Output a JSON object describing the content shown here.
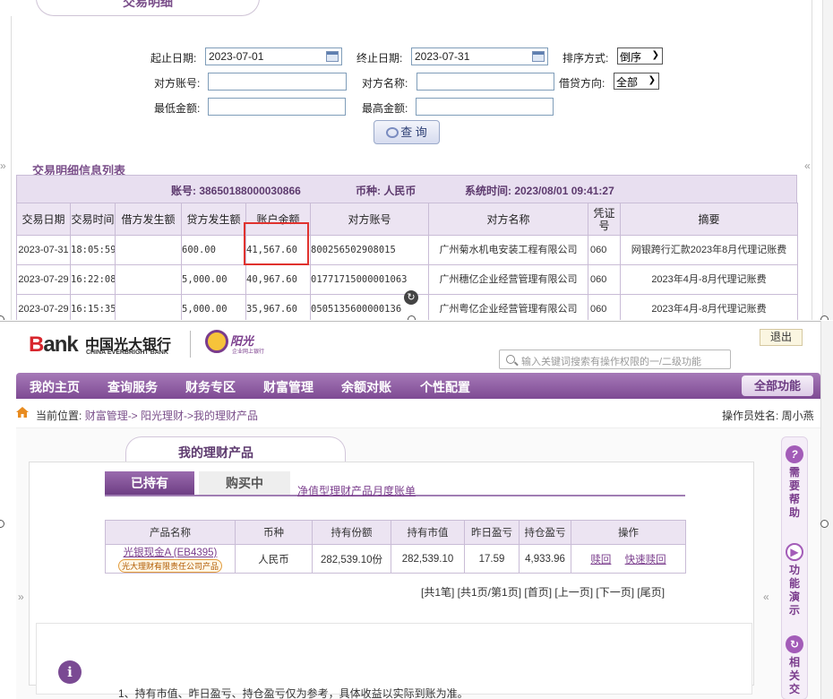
{
  "top": {
    "tab_title": "交易明细",
    "form": {
      "start_label": "起止日期:",
      "start_value": "2023-07-01",
      "end_label": "终止日期:",
      "end_value": "2023-07-31",
      "sort_label": "排序方式:",
      "sort_value": "倒序",
      "counter_acct_label": "对方账号:",
      "counter_name_label": "对方名称:",
      "direction_label": "借贷方向:",
      "direction_value": "全部",
      "min_label": "最低金额:",
      "max_label": "最高金额:",
      "query_label": "查 询"
    },
    "list_title": "交易明细信息列表",
    "account_info": {
      "account": "账号: 38650188000030866",
      "currency": "币种: 人民币",
      "system_time": "系统时间: 2023/08/01 09:41:27"
    },
    "table": {
      "headers": [
        "交易日期",
        "交易时间",
        "借方发生额",
        "贷方发生额",
        "账户余额",
        "对方账号",
        "对方名称",
        "凭证号",
        "摘要"
      ],
      "rows": [
        [
          "2023-07-31",
          "18:05:59",
          "",
          "600.00",
          "41,567.60",
          "800256502908015",
          "广州菊水机电安装工程有限公司",
          "060",
          "网银跨行汇款2023年8月代理记账费"
        ],
        [
          "2023-07-29",
          "16:22:08",
          "",
          "5,000.00",
          "40,967.60",
          "01771715000001063",
          "广州穗亿企业经营管理有限公司",
          "060",
          "2023年4月-8月代理记账费"
        ],
        [
          "2023-07-29",
          "16:15:35",
          "",
          "5,000.00",
          "35,967.60",
          "0505135600000136",
          "广州粤亿企业经营管理有限公司",
          "060",
          "2023年4月-8月代理记账费"
        ]
      ]
    }
  },
  "bottom": {
    "brand": {
      "bank_b": "B",
      "bank_rest": "ank",
      "cn_name": "中国光大银行",
      "en_name": "CHINA EVERBRIGHT BANK",
      "ygg": "阳光",
      "ygg_sub": "企业网上银行"
    },
    "logout": "退出",
    "search_placeholder": "输入关键词搜索有操作权限的一/二级功能",
    "nav": [
      "我的主页",
      "查询服务",
      "财务专区",
      "财富管理",
      "余额对账",
      "个性配置"
    ],
    "all_functions": "全部功能",
    "breadcrumb": {
      "prefix": "当前位置:",
      "path": "财富管理-> 阳光理财->我的理财产品"
    },
    "operator": "操作员姓名: 周小燕",
    "panel_title": "我的理财产品",
    "tabs": [
      "已持有",
      "购买中"
    ],
    "monthly_link": "净值型理财产品月度账单",
    "product_table": {
      "headers": [
        "产品名称",
        "币种",
        "持有份额",
        "持有市值",
        "昨日盈亏",
        "持仓盈亏",
        "操作"
      ],
      "row": {
        "name": "光银现金A (EB4395)",
        "issuer": "光大理财有限责任公司产品",
        "currency": "人民币",
        "shares": "282,539.10份",
        "market_value": "282,539.10",
        "yesterday_pl": "17.59",
        "position_pl": "4,933.96",
        "op1": "赎回",
        "op2": "快速赎回"
      }
    },
    "pager": "[共1笔] [共1页/第1页] [首页] [上一页] [下一页] [尾页]",
    "notice": "1、持有市值、昨日盈亏、持仓盈亏仅为参考，具体收益以实际到账为准。",
    "side": {
      "help": "需要帮助",
      "demo": "功能演示",
      "related": "相关交"
    },
    "colors": {
      "brand_purple": "#7e4a93",
      "accent_red": "#e0322e"
    }
  }
}
